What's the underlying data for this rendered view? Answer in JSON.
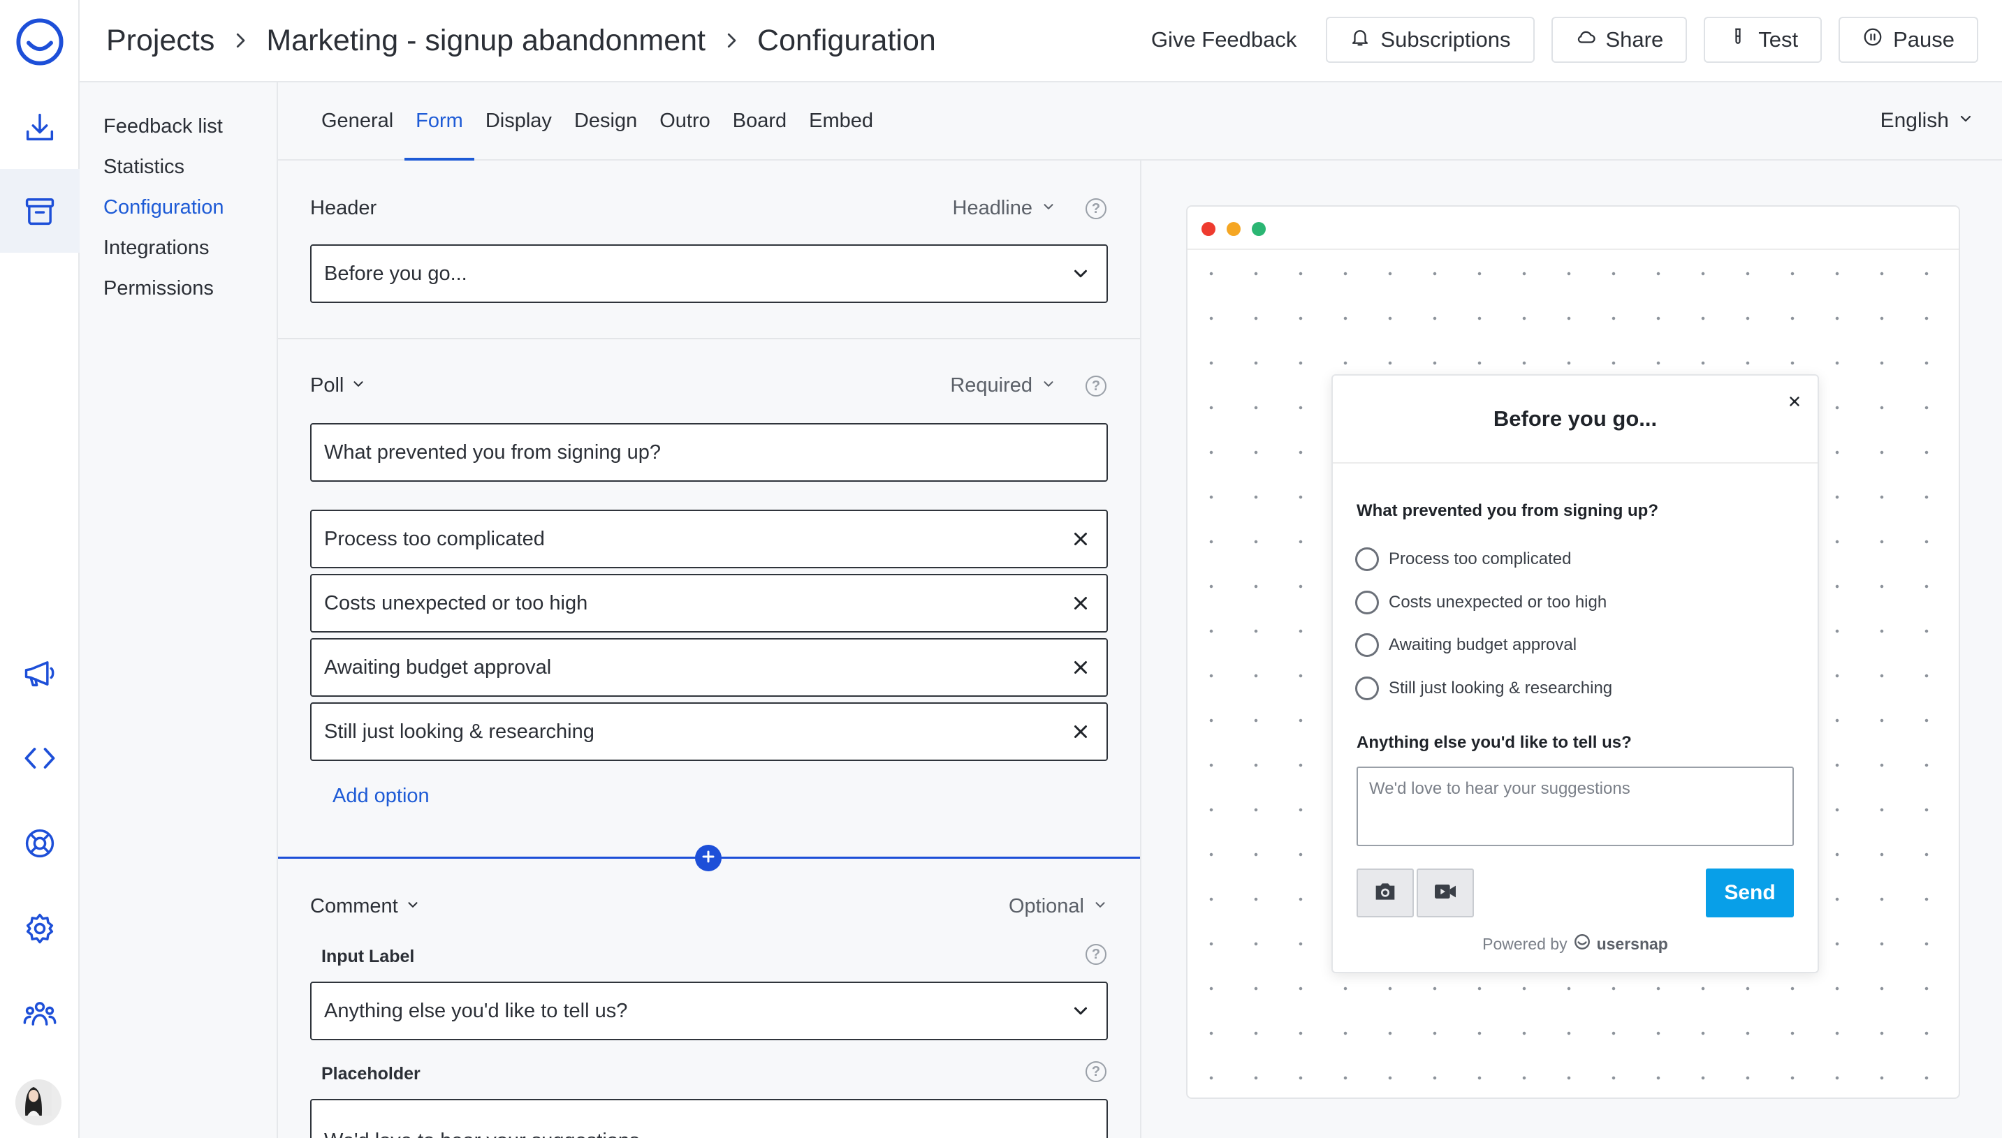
{
  "breadcrumb": {
    "projects": "Projects",
    "project": "Marketing - signup abandonment",
    "current": "Configuration"
  },
  "header": {
    "give_feedback": "Give Feedback",
    "subscriptions": "Subscriptions",
    "share": "Share",
    "test": "Test",
    "pause": "Pause"
  },
  "subnav": {
    "items": [
      {
        "label": "Feedback list",
        "active": false
      },
      {
        "label": "Statistics",
        "active": false
      },
      {
        "label": "Configuration",
        "active": true
      },
      {
        "label": "Integrations",
        "active": false
      },
      {
        "label": "Permissions",
        "active": false
      }
    ]
  },
  "tabs": {
    "items": [
      "General",
      "Form",
      "Display",
      "Design",
      "Outro",
      "Board",
      "Embed"
    ],
    "active": "Form",
    "language": "English"
  },
  "form": {
    "header_section": {
      "label": "Header",
      "type": "Headline",
      "value": "Before you go..."
    },
    "poll_section": {
      "label": "Poll",
      "requirement": "Required",
      "question": "What prevented you from signing up?",
      "options": [
        "Process too complicated",
        "Costs unexpected or too high",
        "Awaiting budget approval",
        "Still just looking & researching"
      ],
      "add_option": "Add option"
    },
    "comment_section": {
      "label": "Comment",
      "requirement": "Optional",
      "input_label_title": "Input Label",
      "input_label_value": "Anything else you'd like to tell us?",
      "placeholder_title": "Placeholder",
      "placeholder_value": "We'd love to hear your suggestions"
    }
  },
  "preview": {
    "title": "Before you go...",
    "question": "What prevented you from signing up?",
    "options": [
      "Process too complicated",
      "Costs unexpected or too high",
      "Awaiting budget approval",
      "Still just looking & researching"
    ],
    "comment_question": "Anything else you'd like to tell us?",
    "comment_placeholder": "We'd love to hear your suggestions",
    "send": "Send",
    "powered_by": "Powered by",
    "brand": "usersnap"
  },
  "colors": {
    "accent": "#1e5bd6",
    "send_button": "#089fe8",
    "traffic_red": "#ee3b2f",
    "traffic_yellow": "#f5a623",
    "traffic_green": "#2bb673"
  },
  "icons": {
    "rail": [
      "usersnap-logo-icon",
      "download-icon",
      "archive-box-icon",
      "megaphone-icon",
      "code-icon",
      "lifebuoy-icon",
      "gear-icon",
      "team-icon"
    ]
  }
}
